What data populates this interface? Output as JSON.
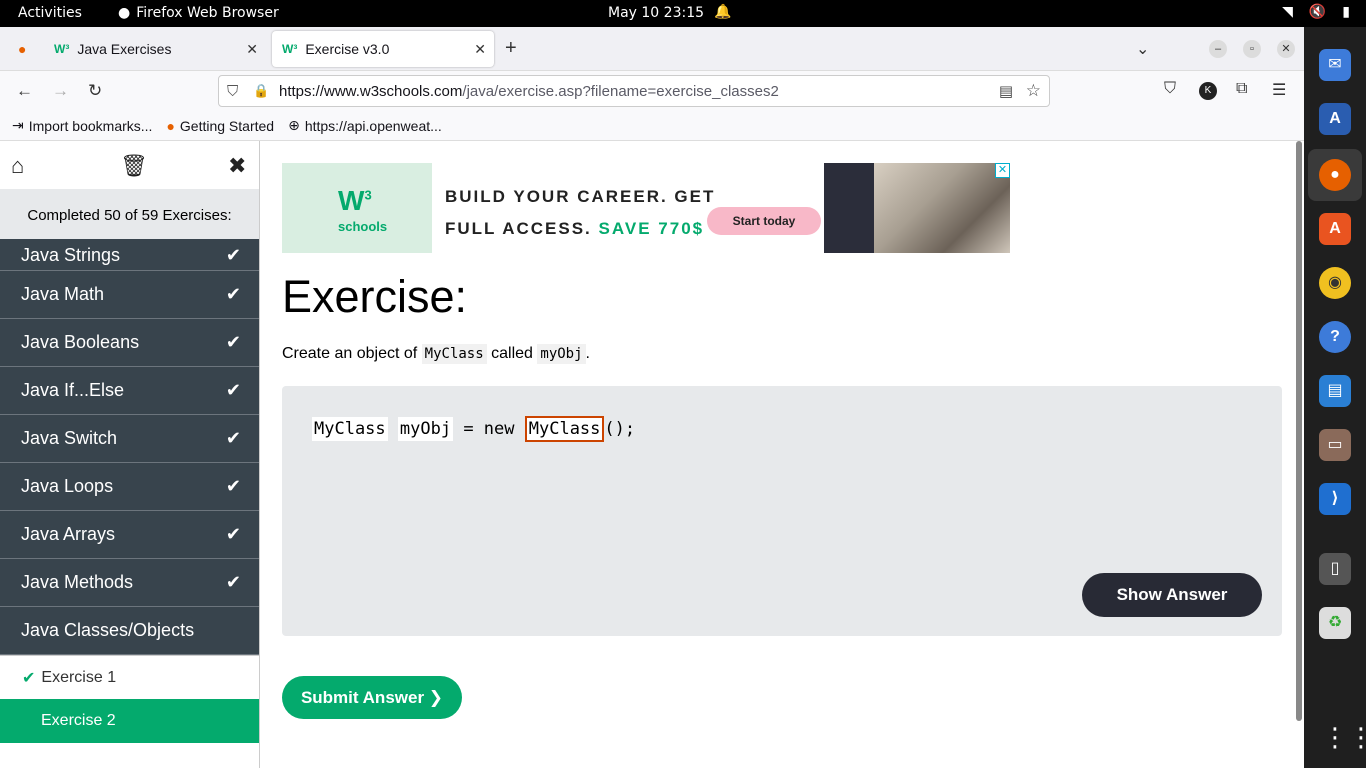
{
  "topbar": {
    "activities": "Activities",
    "app_name": "Firefox Web Browser",
    "clock": "May 10  23:15"
  },
  "browser": {
    "tabs": [
      {
        "label": "Java Exercises",
        "favicon": "W³"
      },
      {
        "label": "Exercise v3.0",
        "favicon": "W³"
      }
    ],
    "url_host": "https://www.w3schools.com",
    "url_path": "/java/exercise.asp?filename=exercise_classes2",
    "bookmarks": [
      {
        "label": "Import bookmarks..."
      },
      {
        "label": "Getting Started"
      },
      {
        "label": "https://api.openweat..."
      }
    ],
    "avatar_initial": "K"
  },
  "sidebar": {
    "progress": "Completed 50 of 59 Exercises:",
    "items": [
      {
        "label": "Java Strings",
        "done": "✔"
      },
      {
        "label": "Java Math",
        "done": "✔"
      },
      {
        "label": "Java Booleans",
        "done": "✔"
      },
      {
        "label": "Java If...Else",
        "done": "✔"
      },
      {
        "label": "Java Switch",
        "done": "✔"
      },
      {
        "label": "Java Loops",
        "done": "✔"
      },
      {
        "label": "Java Arrays",
        "done": "✔"
      },
      {
        "label": "Java Methods",
        "done": "✔"
      },
      {
        "label": "Java Classes/Objects",
        "done": ""
      }
    ],
    "sub_items": [
      {
        "label": "Exercise 1",
        "done": "✔"
      },
      {
        "label": "Exercise 2",
        "done": ""
      }
    ]
  },
  "ad": {
    "logo_w3": "W",
    "logo_sup": "3",
    "logo_schools": "schools",
    "line1": "BUILD YOUR CAREER. GET",
    "line2": "FULL ACCESS.",
    "save": "SAVE 770$",
    "cta": "Start today"
  },
  "exercise": {
    "title": "Exercise:",
    "desc_prefix": "Create an object of",
    "desc_code1": "MyClass",
    "desc_mid": "called",
    "desc_code2": "myObj",
    "desc_suffix": ".",
    "code": {
      "tok1": "MyClass",
      "tok2": "myObj",
      "mid": " = new ",
      "answer": "MyClass",
      "end": "();"
    },
    "show_answer": "Show Answer",
    "submit": "Submit Answer ❯"
  }
}
